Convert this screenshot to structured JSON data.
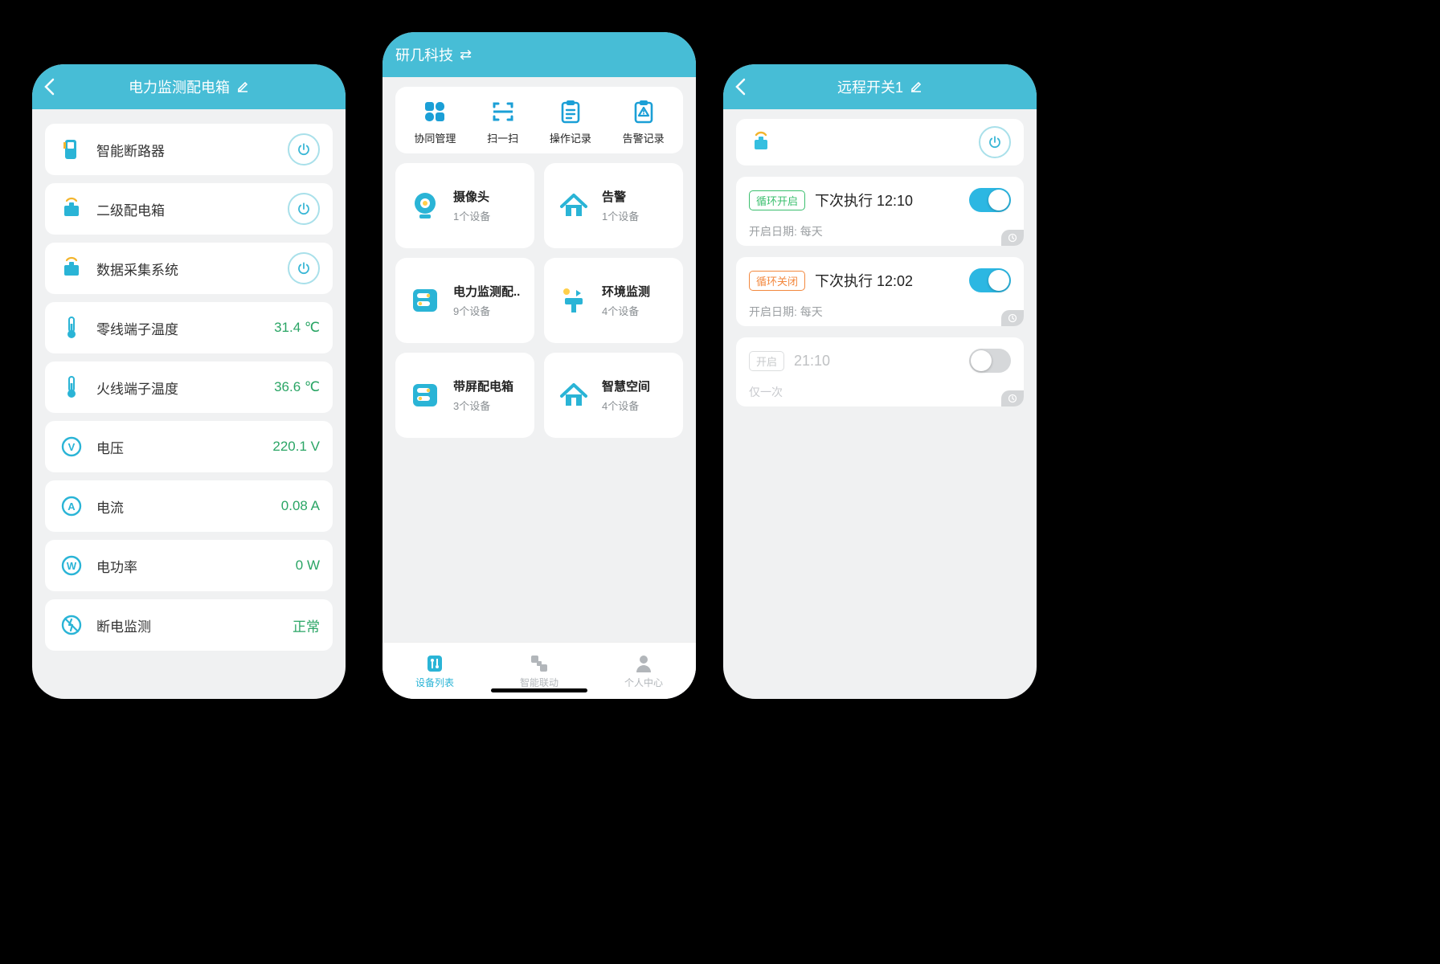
{
  "colors": {
    "brand": "#47bdd6",
    "green": "#2aa565",
    "orange": "#f3883e",
    "toggle": "#2cb7e2"
  },
  "phone1": {
    "title": "电力监测配电箱",
    "rows": [
      {
        "icon": "breaker",
        "label": "智能断路器",
        "power": true
      },
      {
        "icon": "box",
        "label": "二级配电箱",
        "power": true
      },
      {
        "icon": "box",
        "label": "数据采集系统",
        "power": true
      },
      {
        "icon": "thermo",
        "label": "零线端子温度",
        "value": "31.4 ℃"
      },
      {
        "icon": "thermo",
        "label": "火线端子温度",
        "value": "36.6 ℃"
      },
      {
        "icon": "circV",
        "label": "电压",
        "value": "220.1 V"
      },
      {
        "icon": "circA",
        "label": "电流",
        "value": "0.08 A"
      },
      {
        "icon": "circW",
        "label": "电功率",
        "value": "0 W"
      },
      {
        "icon": "nopower",
        "label": "断电监测",
        "value": "正常"
      }
    ]
  },
  "phone2": {
    "title": "研几科技",
    "tools": [
      {
        "label": "协同管理"
      },
      {
        "label": "扫一扫"
      },
      {
        "label": "操作记录"
      },
      {
        "label": "告警记录"
      }
    ],
    "cards": [
      {
        "icon": "camera",
        "title": "摄像头",
        "sub": "1个设备"
      },
      {
        "icon": "house",
        "title": "告警",
        "sub": "1个设备"
      },
      {
        "icon": "panel",
        "title": "电力监测配..",
        "sub": "9个设备"
      },
      {
        "icon": "env",
        "title": "环境监测",
        "sub": "4个设备"
      },
      {
        "icon": "panel",
        "title": "带屏配电箱",
        "sub": "3个设备"
      },
      {
        "icon": "house",
        "title": "智慧空间",
        "sub": "4个设备"
      }
    ],
    "tabs": [
      {
        "label": "设备列表",
        "active": true
      },
      {
        "label": "智能联动",
        "active": false
      },
      {
        "label": "个人中心",
        "active": false
      }
    ]
  },
  "phone3": {
    "title": "远程开关1",
    "schedules": [
      {
        "tag": "循环开启",
        "tagClass": "green",
        "exec": "下次执行 12:10",
        "on": true,
        "note": "开启日期: 每天"
      },
      {
        "tag": "循环关闭",
        "tagClass": "orange",
        "exec": "下次执行 12:02",
        "on": true,
        "note": "开启日期: 每天"
      },
      {
        "tag": "开启",
        "tagClass": "grey",
        "exec": "21:10",
        "on": false,
        "note": "仅一次",
        "disabled": true
      }
    ]
  }
}
